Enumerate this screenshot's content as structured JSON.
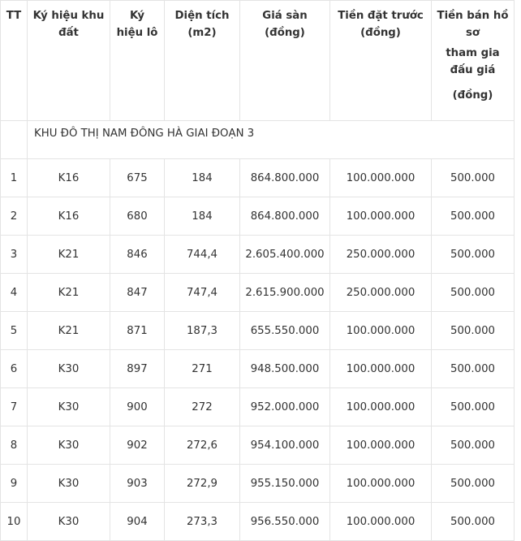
{
  "table": {
    "headers": {
      "tt": "TT",
      "land_code": [
        "Ký hiệu khu",
        "đất"
      ],
      "lot_code": [
        "Ký",
        "hiệu lô"
      ],
      "area": [
        "Diện tích",
        "(m2)"
      ],
      "floor_price": [
        "Giá sàn",
        "(đồng)"
      ],
      "deposit": [
        "Tiền đặt trước",
        "(đồng)"
      ],
      "dossier_fee": [
        "Tiền bán hồ",
        "sơ",
        "tham gia",
        "đấu giá",
        "(đồng)"
      ]
    },
    "section_title": "KHU ĐÔ THỊ NAM ĐÔNG HÀ GIAI ĐOẠN 3",
    "rows": [
      [
        "1",
        "K16",
        "675",
        "184",
        "864.800.000",
        "100.000.000",
        "500.000"
      ],
      [
        "2",
        "K16",
        "680",
        "184",
        "864.800.000",
        "100.000.000",
        "500.000"
      ],
      [
        "3",
        "K21",
        "846",
        "744,4",
        "2.605.400.000",
        "250.000.000",
        "500.000"
      ],
      [
        "4",
        "K21",
        "847",
        "747,4",
        "2.615.900.000",
        "250.000.000",
        "500.000"
      ],
      [
        "5",
        "K21",
        "871",
        "187,3",
        "655.550.000",
        "100.000.000",
        "500.000"
      ],
      [
        "6",
        "K30",
        "897",
        "271",
        "948.500.000",
        "100.000.000",
        "500.000"
      ],
      [
        "7",
        "K30",
        "900",
        "272",
        "952.000.000",
        "100.000.000",
        "500.000"
      ],
      [
        "8",
        "K30",
        "902",
        "272,6",
        "954.100.000",
        "100.000.000",
        "500.000"
      ],
      [
        "9",
        "K30",
        "903",
        "272,9",
        "955.150.000",
        "100.000.000",
        "500.000"
      ],
      [
        "10",
        "K30",
        "904",
        "273,3",
        "956.550.000",
        "100.000.000",
        "500.000"
      ]
    ]
  }
}
